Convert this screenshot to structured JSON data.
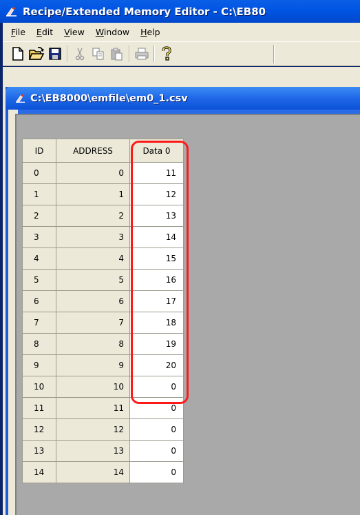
{
  "window": {
    "title": "Recipe/Extended Memory Editor - C:\\EB80"
  },
  "menu": {
    "items": [
      "File",
      "Edit",
      "View",
      "Window",
      "Help"
    ]
  },
  "toolbar": {
    "buttons": [
      "new-icon",
      "open-icon",
      "save-icon",
      "cut-icon",
      "copy-icon",
      "paste-icon",
      "print-icon",
      "help-icon"
    ]
  },
  "child_window": {
    "title": "C:\\EB8000\\emfile\\em0_1.csv"
  },
  "grid": {
    "columns": [
      "ID",
      "ADDRESS",
      "Data 0"
    ],
    "rows": [
      {
        "id": "0",
        "address": "0",
        "data": "11"
      },
      {
        "id": "1",
        "address": "1",
        "data": "12"
      },
      {
        "id": "2",
        "address": "2",
        "data": "13"
      },
      {
        "id": "3",
        "address": "3",
        "data": "14"
      },
      {
        "id": "4",
        "address": "4",
        "data": "15"
      },
      {
        "id": "5",
        "address": "5",
        "data": "16"
      },
      {
        "id": "6",
        "address": "6",
        "data": "17"
      },
      {
        "id": "7",
        "address": "7",
        "data": "18"
      },
      {
        "id": "8",
        "address": "8",
        "data": "19"
      },
      {
        "id": "9",
        "address": "9",
        "data": "20"
      },
      {
        "id": "10",
        "address": "10",
        "data": "0"
      },
      {
        "id": "11",
        "address": "11",
        "data": "0"
      },
      {
        "id": "12",
        "address": "12",
        "data": "0"
      },
      {
        "id": "13",
        "address": "13",
        "data": "0"
      },
      {
        "id": "14",
        "address": "14",
        "data": "0"
      }
    ]
  },
  "colors": {
    "highlight": "#ff1a1a",
    "title_bar": "#0054e3"
  }
}
